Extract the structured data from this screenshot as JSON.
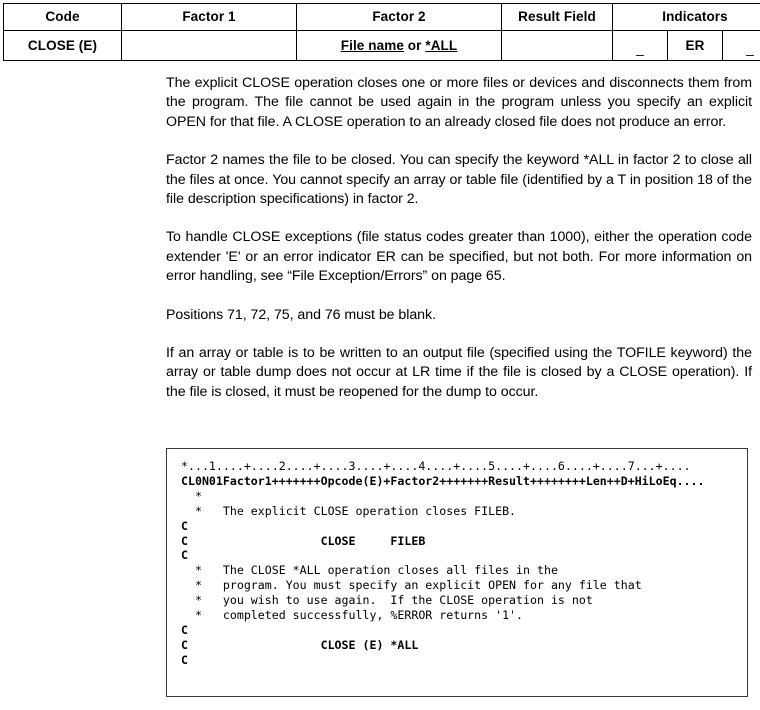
{
  "op_table": {
    "headers": [
      "Code",
      "Factor 1",
      "Factor 2",
      "Result Field",
      "Indicators"
    ],
    "row": {
      "code": "CLOSE (E)",
      "factor1": "",
      "factor2_part1": "File name",
      "factor2_sep": " or ",
      "factor2_part2": "*ALL",
      "result_field": "",
      "indicator_1": "_",
      "indicator_2": "ER",
      "indicator_3": "_"
    }
  },
  "prose": {
    "p1": "The explicit CLOSE operation closes one or more files or devices and disconnects them from the program. The file cannot be used again in the program unless you specify an explicit OPEN for that file. A CLOSE operation to an already closed file does not produce an error.",
    "p2": "Factor 2 names the file to be closed. You can specify the keyword *ALL in factor 2 to close all the files at once. You cannot specify an array or table file (identified by a T in position 18 of the file description specifications) in factor 2.",
    "p3": "To handle CLOSE exceptions (file status codes greater than 1000), either the operation code extender 'E' or an error indicator ER can be specified, but not both. For more information on error handling, see “File Exception/Errors” on page 65.",
    "p4": "Positions 71, 72, 75, and 76 must be blank.",
    "p5": "If an array or table is to be written to an output file (specified using the TOFILE keyword) the array or table dump does not occur at LR time if the file is closed by a CLOSE operation). If the file is closed, it must be reopened for the dump to occur."
  },
  "code_example": {
    "ruler": "*...1....+....2....+....3....+....4....+....5....+....6....+....7...+....",
    "spec_header": "CL0N01Factor1+++++++Opcode(E)+Factor2+++++++Result++++++++Len++D+HiLoEq....",
    "lines": [
      "  *",
      "  *   The explicit CLOSE operation closes FILEB.",
      "C",
      "C                   CLOSE     FILEB",
      "C",
      "  *   The CLOSE *ALL operation closes all files in the",
      "  *   program. You must specify an explicit OPEN for any file that",
      "  *   you wish to use again.  If the CLOSE operation is not",
      "  *   completed successfully, %ERROR returns '1'.",
      "C",
      "C                   CLOSE (E) *ALL",
      "C"
    ]
  },
  "colors": {
    "border": "#000000",
    "code_border": "#3a3a3a",
    "text": "#000000",
    "background": "#ffffff"
  }
}
